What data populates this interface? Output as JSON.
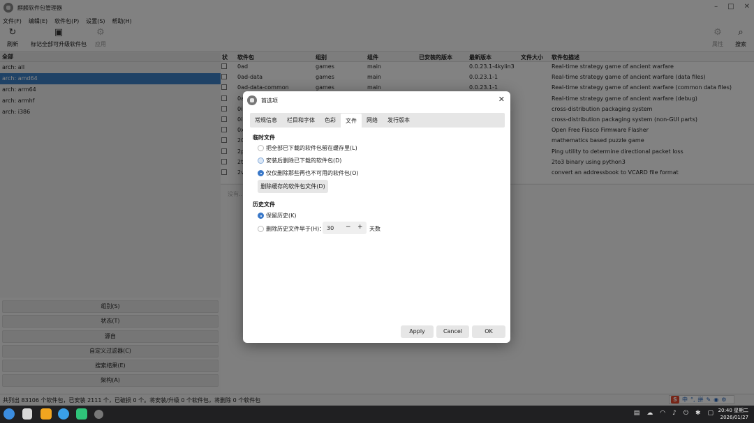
{
  "app": {
    "title": "麒麟软件包管理器",
    "menu": [
      "文件(F)",
      "编辑(E)",
      "软件包(P)",
      "设置(S)",
      "帮助(H)"
    ],
    "toolbar": {
      "refresh": "刷新",
      "mark_all_upgrades": "标记全部可升级软件包",
      "apply": "应用",
      "properties": "属性",
      "search": "搜索"
    },
    "left_panel": {
      "header": "全部",
      "items": [
        "arch: all",
        "arch: amd64",
        "arch: arm64",
        "arch: armhf",
        "arch: i386"
      ],
      "selected_index": 1
    },
    "filter_buttons": [
      "组别(S)",
      "状态(T)",
      "源自",
      "自定义过滤器(C)",
      "搜索结果(E)",
      "架构(A)"
    ],
    "table": {
      "columns": [
        "状",
        "软件包",
        "组别",
        "组件",
        "已安装的版本",
        "最新版本",
        "文件大小",
        "软件包描述"
      ],
      "rows": [
        {
          "pkg": "0ad",
          "group": "games",
          "comp": "main",
          "latest": "0.0.23.1-4kylin3",
          "desc": "Real-time strategy game of ancient warfare"
        },
        {
          "pkg": "0ad-data",
          "group": "games",
          "comp": "main",
          "latest": "0.0.23.1-1",
          "desc": "Real-time strategy game of ancient warfare (data files)"
        },
        {
          "pkg": "0ad-data-common",
          "group": "games",
          "comp": "main",
          "latest": "0.0.23.1-1",
          "desc": "Real-time strategy game of ancient warfare (common data files)"
        },
        {
          "pkg": "0a",
          "group": "",
          "comp": "",
          "latest": "",
          "desc": "Real-time strategy game of ancient warfare (debug)"
        },
        {
          "pkg": "0i",
          "group": "",
          "comp": "",
          "latest": "",
          "desc": "cross-distribution packaging system"
        },
        {
          "pkg": "0i",
          "group": "",
          "comp": "",
          "latest": "",
          "desc": "cross-distribution packaging system (non-GUI parts)"
        },
        {
          "pkg": "0x",
          "group": "",
          "comp": "",
          "latest": "",
          "desc": "Open Free Fiasco Firmware Flasher"
        },
        {
          "pkg": "20",
          "group": "",
          "comp": "",
          "latest": "",
          "desc": "mathematics based puzzle game"
        },
        {
          "pkg": "2p",
          "group": "",
          "comp": "",
          "latest": "",
          "desc": "Ping utility to determine directional packet loss"
        },
        {
          "pkg": "2t",
          "group": "",
          "comp": "",
          "latest": "",
          "desc": "2to3 binary using python3"
        },
        {
          "pkg": "2v",
          "group": "",
          "comp": "",
          "latest": "",
          "desc": "convert an addressbook to VCARD file format"
        }
      ]
    },
    "detail_placeholder": "没有...",
    "status_text": "共列出 83106 个软件包，已安装 2111 个，已破损 0 个。将安装/升级 0 个软件包，将删除 0 个软件包",
    "ime": {
      "logo": "S",
      "items": [
        "中",
        "°,",
        "拼"
      ]
    }
  },
  "taskbar": {
    "time": "20:40 星期二",
    "date": "2026/01/27"
  },
  "dialog": {
    "title": "首选项",
    "tabs": [
      "常规信息",
      "栏目和字体",
      "色彩",
      "文件",
      "网络",
      "发行版本"
    ],
    "active_tab": 3,
    "temp_files": {
      "title": "临时文件",
      "options": [
        {
          "label": "把全部已下载的软件包留在缓存里(L)",
          "state": "unchecked"
        },
        {
          "label": "安装后删除已下载的软件包(D)",
          "state": "hover"
        },
        {
          "label": "仅仅删除那些再也不可用的软件包(O)",
          "state": "checked"
        }
      ],
      "clear_button": "删除缓存的软件包文件(D)"
    },
    "history": {
      "title": "历史文件",
      "keep_label": "保留历史(K)",
      "keep_checked": true,
      "delete_label": "删除历史文件早于(H)：",
      "days_value": "30",
      "unit": "天数"
    },
    "buttons": {
      "apply": "Apply",
      "cancel": "Cancel",
      "ok": "OK"
    }
  },
  "colors": {
    "accent": "#3a78c8",
    "selection": "#3d7fc4"
  }
}
